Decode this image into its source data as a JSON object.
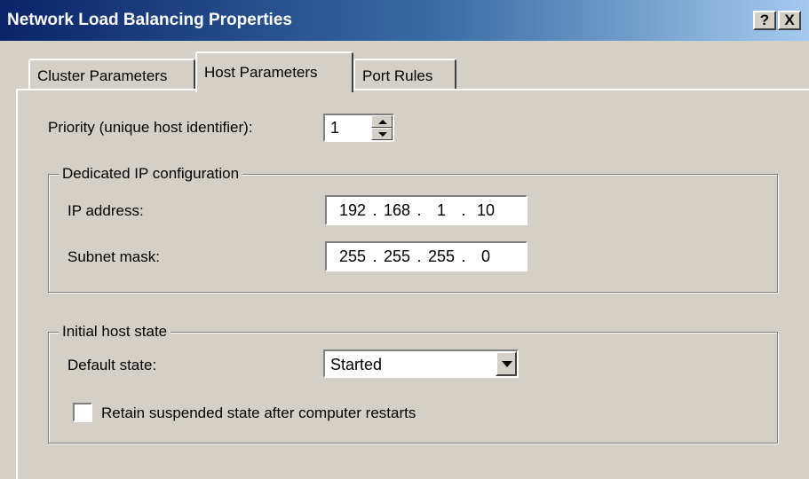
{
  "window": {
    "title": "Network Load Balancing Properties",
    "help_button": "?",
    "close_button": "X"
  },
  "tabs": [
    {
      "label": "Cluster Parameters",
      "selected": false
    },
    {
      "label": "Host Parameters",
      "selected": true
    },
    {
      "label": "Port Rules",
      "selected": false
    }
  ],
  "priority": {
    "label": "Priority (unique host identifier):",
    "value": "1"
  },
  "dedicated_ip": {
    "group_label": "Dedicated IP configuration",
    "ip_address_label": "IP address:",
    "ip_address": [
      "192",
      "168",
      "1",
      "10"
    ],
    "subnet_mask_label": "Subnet mask:",
    "subnet_mask": [
      "255",
      "255",
      "255",
      "0"
    ]
  },
  "initial_state": {
    "group_label": "Initial host state",
    "default_state_label": "Default state:",
    "default_state_value": "Started",
    "retain_label": "Retain suspended state after computer restarts",
    "retain_checked": false
  }
}
